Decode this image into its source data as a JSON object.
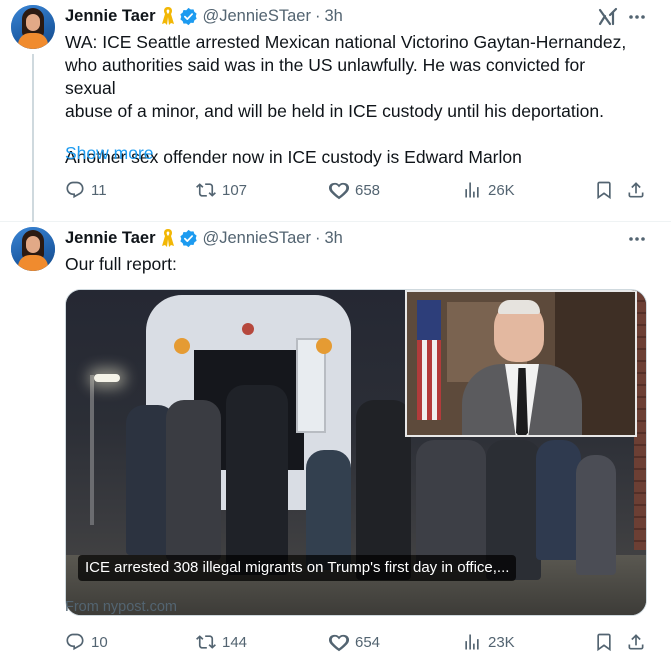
{
  "tweets": [
    {
      "author": {
        "name": "Jennie Taer",
        "handle": "@JennieSTaer",
        "time": "3h"
      },
      "text_lines": [
        "WA: ICE Seattle arrested Mexican national Victorino Gaytan-Hernandez,",
        "who authorities said was in the US unlawfully. He was convicted for sexual",
        "abuse of a minor, and will be held in ICE custody until his deportation."
      ],
      "text_line2": "Another sex offender now in ICE custody is Edward Marlon",
      "show_more": "Show more",
      "stats": {
        "replies": "11",
        "reposts": "107",
        "likes": "658",
        "views": "26K"
      }
    },
    {
      "author": {
        "name": "Jennie Taer",
        "handle": "@JennieSTaer",
        "time": "3h"
      },
      "text": "Our full report:",
      "card": {
        "caption": "ICE arrested 308 illegal migrants on Trump's first day in office,...",
        "source": "From nypost.com"
      },
      "stats": {
        "replies": "10",
        "reposts": "144",
        "likes": "654",
        "views": "23K"
      }
    }
  ],
  "separator": "·",
  "colors": {
    "accent": "#1d9bf0",
    "secondary_text": "#536471",
    "verified_badge": "#1d9bf0",
    "ribbon": "#f2b705"
  },
  "icons": [
    "yellow-ribbon-icon",
    "verified-badge-icon",
    "grok-icon",
    "more-icon",
    "reply-icon",
    "repost-icon",
    "like-icon",
    "views-icon",
    "bookmark-icon",
    "share-icon"
  ]
}
